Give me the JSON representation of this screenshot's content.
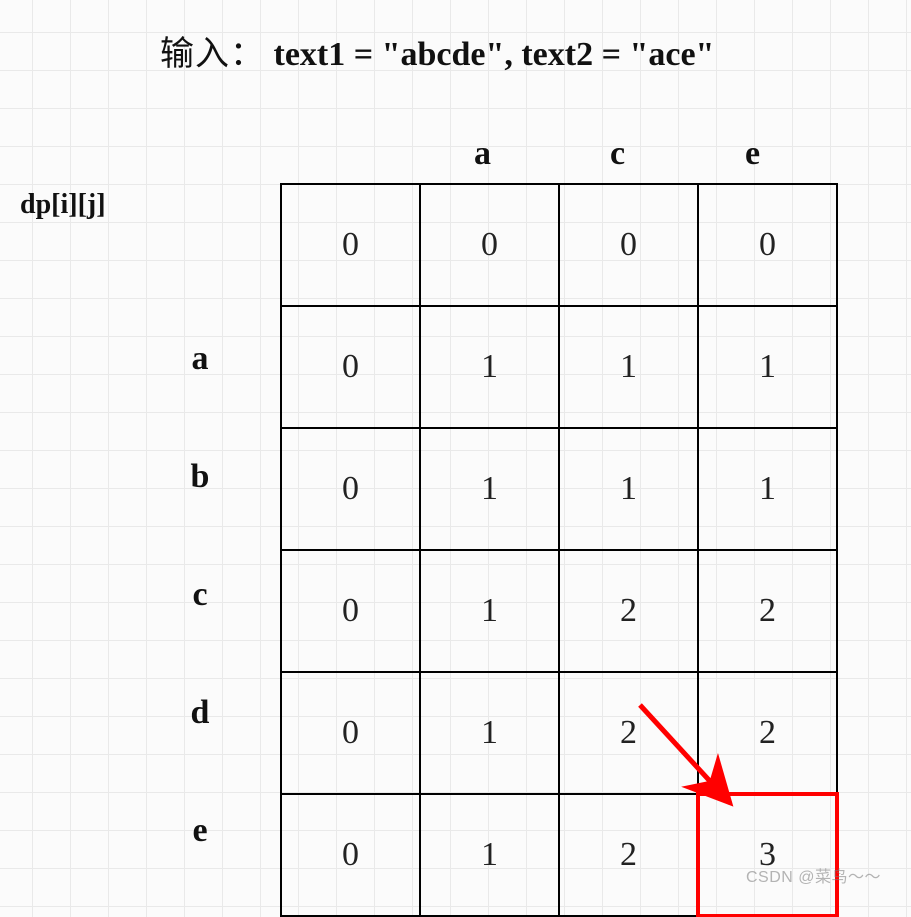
{
  "title": {
    "prefix": "输入：",
    "body": "text1 = \"abcde\", text2 = \"ace\""
  },
  "axis_label": "dp[i][j]",
  "col_headers": [
    "",
    "a",
    "c",
    "e"
  ],
  "row_headers": [
    "",
    "a",
    "b",
    "c",
    "d",
    "e"
  ],
  "chart_data": {
    "type": "table",
    "title": "LCS DP table for text1=\"abcde\", text2=\"ace\"",
    "row_labels": [
      "",
      "a",
      "b",
      "c",
      "d",
      "e"
    ],
    "col_labels": [
      "",
      "a",
      "c",
      "e"
    ],
    "values": [
      [
        0,
        0,
        0,
        0
      ],
      [
        0,
        1,
        1,
        1
      ],
      [
        0,
        1,
        1,
        1
      ],
      [
        0,
        1,
        2,
        2
      ],
      [
        0,
        1,
        2,
        2
      ],
      [
        0,
        1,
        2,
        3
      ]
    ],
    "highlight": {
      "row": 5,
      "col": 3
    },
    "arrow": {
      "from_row": 4,
      "from_col": 2,
      "to_row": 5,
      "to_col": 3
    }
  },
  "watermark": "CSDN @菜鸟～～"
}
